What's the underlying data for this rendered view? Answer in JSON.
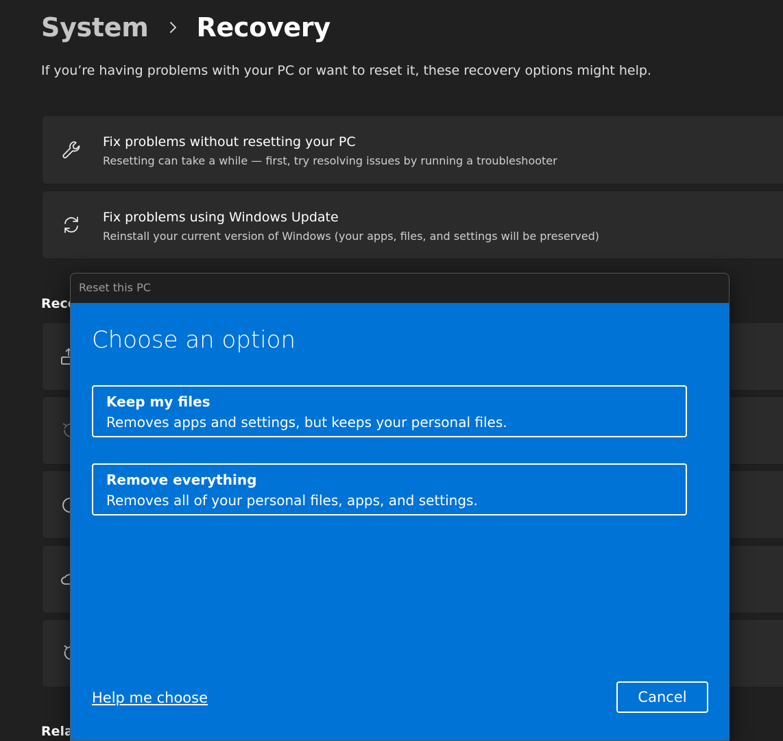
{
  "header": {
    "breadcrumb_parent": "System",
    "breadcrumb_current": "Recovery",
    "description": "If you’re having problems with your PC or want to reset it, these recovery options might help."
  },
  "cards": [
    {
      "icon": "wrench-icon",
      "title": "Fix problems without resetting your PC",
      "subtitle": "Resetting can take a while — first, try resolving issues by running a troubleshooter"
    },
    {
      "icon": "sync-icon",
      "title": "Fix problems using Windows Update",
      "subtitle": "Reinstall your current version of Windows (your apps, files, and settings will be preserved)"
    }
  ],
  "sections": {
    "recovery_label": "Reco",
    "related_label": "Relat"
  },
  "dialog": {
    "title": "Reset this PC",
    "heading": "Choose an option",
    "options": [
      {
        "title": "Keep my files",
        "subtitle": "Removes apps and settings, but keeps your personal files."
      },
      {
        "title": "Remove everything",
        "subtitle": "Removes all of your personal files, apps, and settings."
      }
    ],
    "help_link": "Help me choose",
    "cancel_label": "Cancel"
  },
  "colors": {
    "page_bg": "#202020",
    "card_bg": "#2b2b2b",
    "dialog_blue": "#0073d6",
    "dialog_titlebar": "#1f1f1f"
  }
}
